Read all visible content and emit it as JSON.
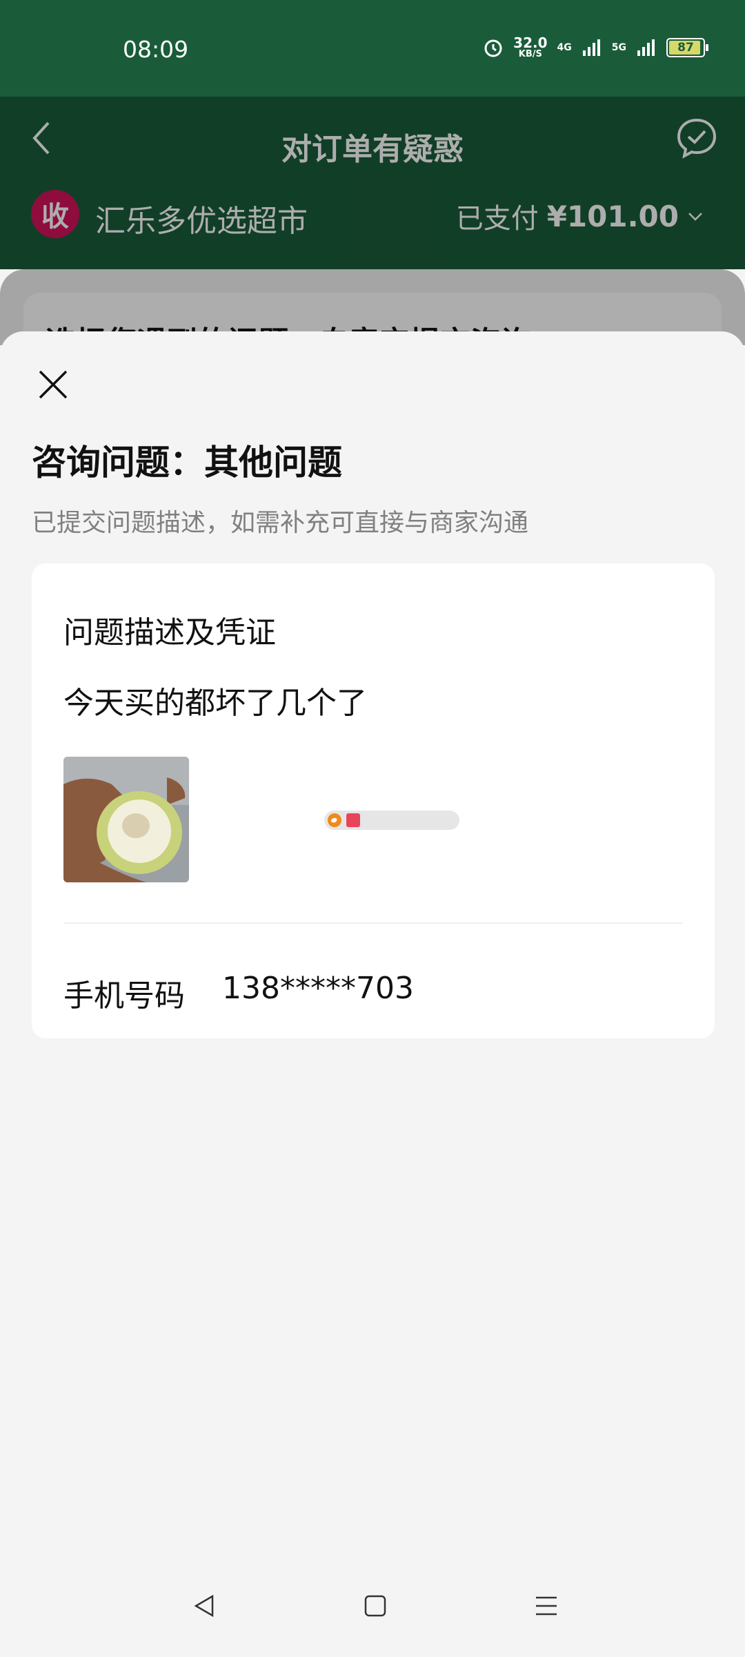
{
  "status_bar": {
    "time": "08:09",
    "speed_value": "32.0",
    "speed_unit": "KB/S",
    "network_1": "4G",
    "network_2": "5G",
    "battery": "87"
  },
  "header": {
    "title": "对订单有疑惑",
    "merchant_avatar_char": "收",
    "merchant_name": "汇乐多优选超市",
    "paid_label": "已支付",
    "paid_amount": "¥101.00"
  },
  "underlay": {
    "partial_text": "选择您遇到的问题，自音宝提交咨询"
  },
  "sheet": {
    "title": "咨询问题：其他问题",
    "subtitle": "已提交问题描述，如需补充可直接与商家沟通",
    "section_title": "问题描述及凭证",
    "description": "今天买的都坏了几个了",
    "phone_label": "手机号码",
    "phone_value": "138*****703"
  },
  "colors": {
    "header_green": "#1a5c3a",
    "avatar_red": "#d2145a",
    "background": "#f4f4f4"
  }
}
